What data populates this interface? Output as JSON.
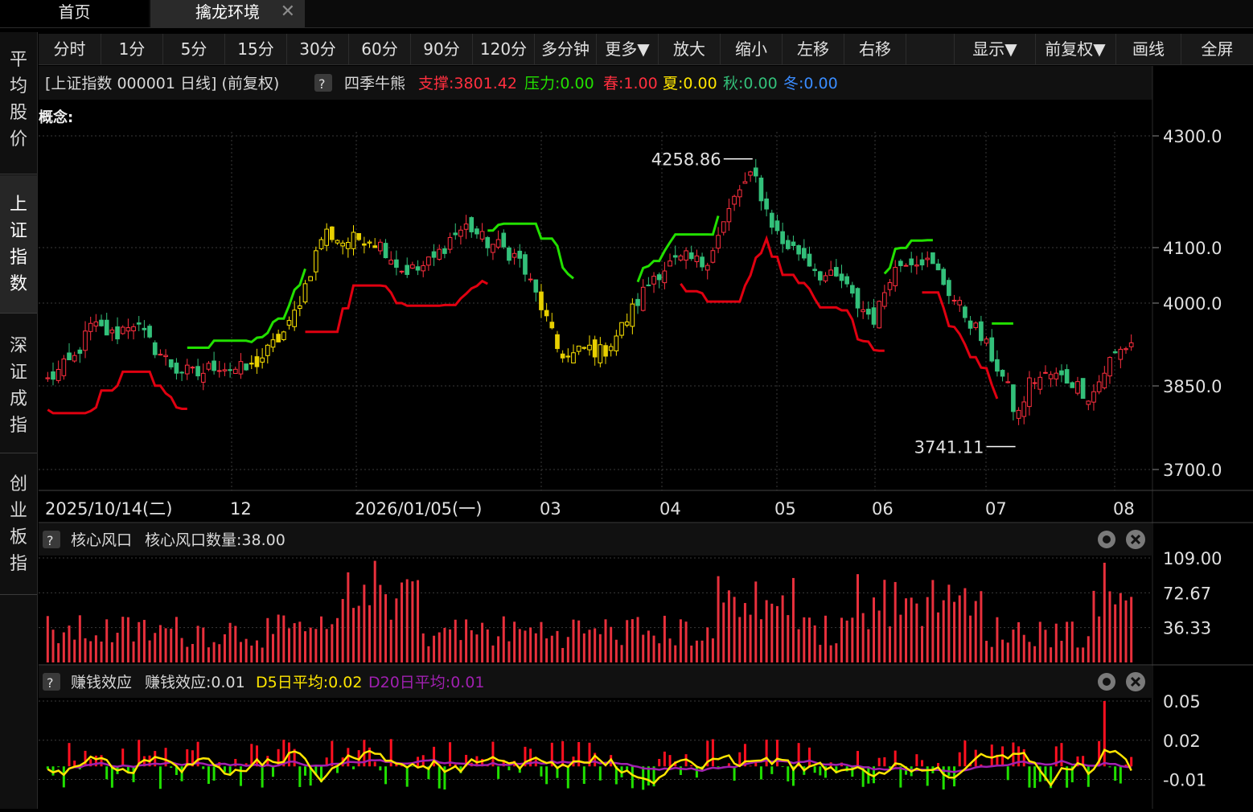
{
  "tabs": {
    "home": "首页",
    "active": "擒龙环境",
    "close_icon": "close-icon"
  },
  "sidebar": [
    {
      "label": [
        "平",
        "均",
        "股",
        "价"
      ]
    },
    {
      "label": [
        "上",
        "证",
        "指",
        "数"
      ]
    },
    {
      "label": [
        "深",
        "证",
        "成",
        "指"
      ]
    },
    {
      "label": [
        "创",
        "业",
        "板",
        "指"
      ]
    }
  ],
  "toolbar": [
    "分时",
    "1分",
    "5分",
    "15分",
    "30分",
    "60分",
    "90分",
    "120分",
    "多分钟",
    "更多▼",
    "放大",
    "缩小",
    "左移",
    "右移",
    "显示▼",
    "前复权▼",
    "画线",
    "全屏"
  ],
  "main_header": {
    "title": "[上证指数 000001 日线]  (前复权)",
    "help": "?",
    "indicator": "四季牛熊",
    "support": "支撑:3801.42",
    "pressure": "压力:0.00",
    "spring": "春:1.00",
    "summer": "夏:0.00",
    "autumn": "秋:0.00",
    "winter": "冬:0.00",
    "concept": "概念:"
  },
  "colors": {
    "up": "#ff2f3f",
    "down": "#33c07a",
    "yellow": "#ffe600",
    "green_line": "#22e000",
    "red_line": "#e00010",
    "purple": "#a020b0"
  },
  "chart_data": [
    {
      "type": "candlestick",
      "title": "",
      "y_axis_ticks": [
        "4300.0",
        "4100.0",
        "4000.0",
        "3850.0",
        "3700.0"
      ],
      "ylim": [
        3700,
        4300
      ],
      "x_labels": [
        "2025/10/14(二)",
        "12",
        "2026/01/05(一)",
        "03",
        "04",
        "05",
        "06",
        "07",
        "08"
      ],
      "annotations": [
        {
          "text": "4258.86",
          "value": 4258.86
        },
        {
          "text": "3741.11",
          "value": 3741.11
        }
      ],
      "candles": []
    },
    {
      "type": "bar",
      "header": {
        "help": "?",
        "name": "核心风口",
        "value": "核心风口数量:38.00"
      },
      "y_axis_ticks": [
        "109.00",
        "72.67",
        "36.33"
      ],
      "ylim": [
        0,
        109
      ],
      "values": []
    },
    {
      "type": "bar+line",
      "header": {
        "help": "?",
        "name": "赚钱效应",
        "value": "赚钱效应:0.01",
        "d5": "D5日平均:0.02",
        "d20": "D20日平均:0.01"
      },
      "y_axis_ticks": [
        "0.05",
        "0.02",
        "-0.01"
      ],
      "ylim": [
        -0.03,
        0.05
      ],
      "values": [],
      "d5": [],
      "d20": []
    }
  ]
}
